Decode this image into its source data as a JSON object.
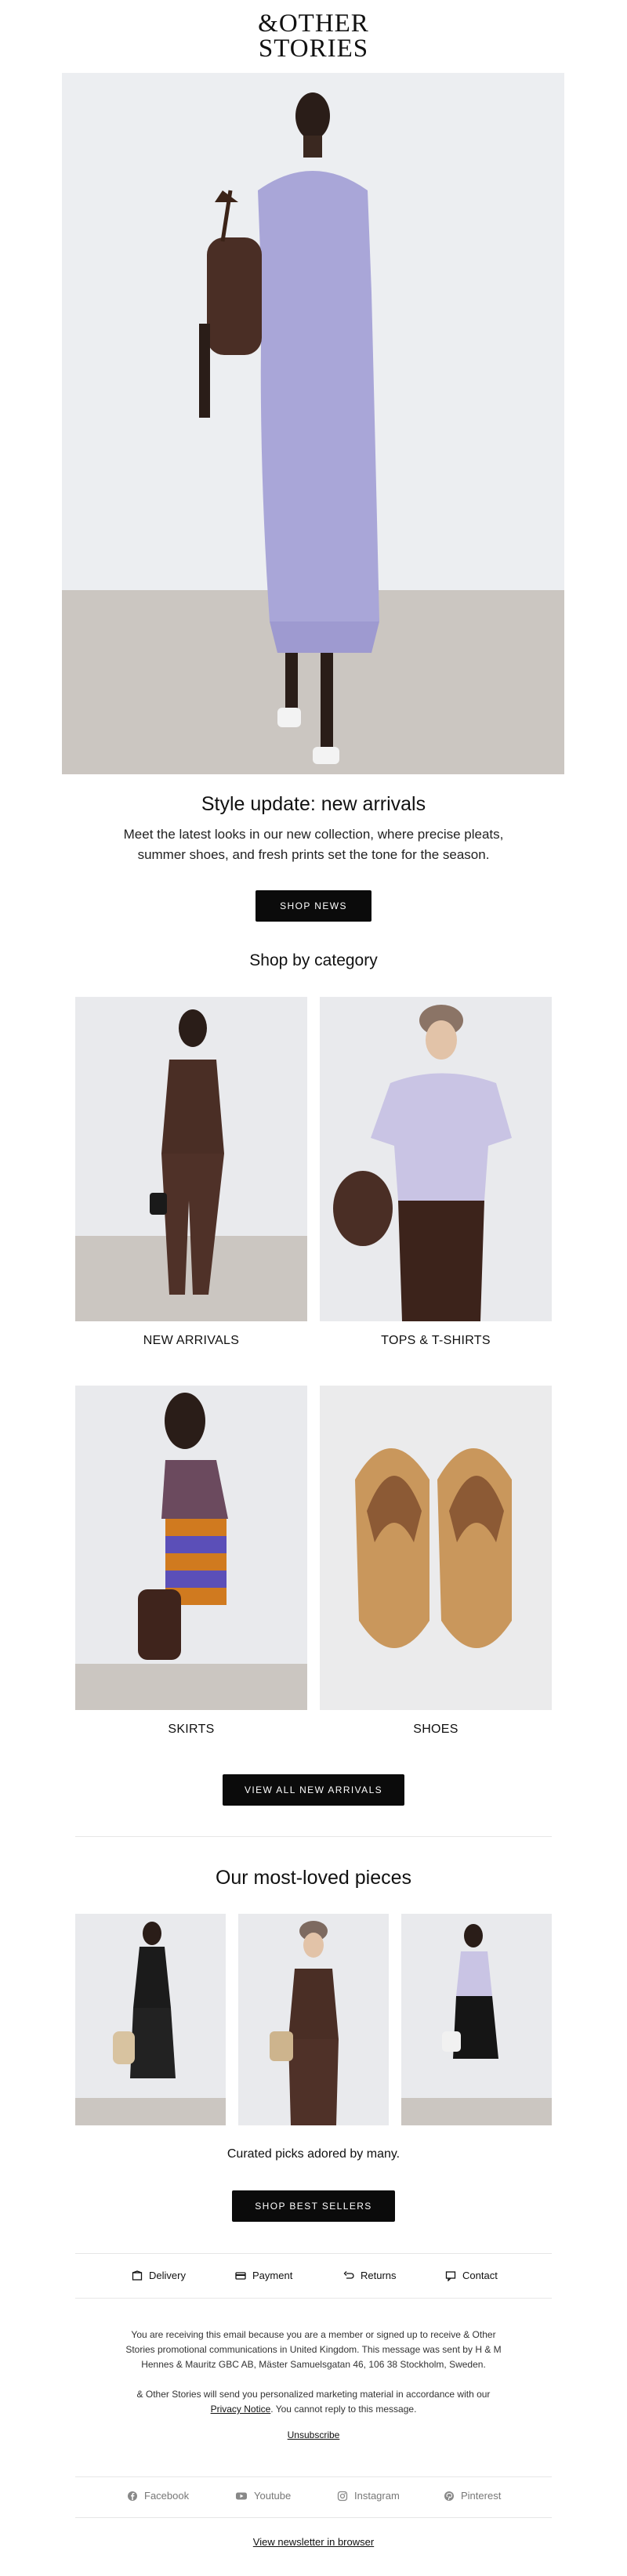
{
  "brand": {
    "logo_line1": "&OTHER",
    "logo_line2": "STORIES"
  },
  "hero": {
    "title": "Style update: new arrivals",
    "text_line1": "Meet the latest looks in our new collection, where precise pleats,",
    "text_line2": "summer shoes, and fresh prints set the tone for the season.",
    "button": "SHOP NEWS"
  },
  "categories": {
    "title": "Shop by category",
    "items": [
      {
        "label": "NEW ARRIVALS"
      },
      {
        "label": "TOPS & T-SHIRTS"
      },
      {
        "label": "SKIRTS"
      },
      {
        "label": "SHOES"
      }
    ],
    "button": "VIEW ALL NEW ARRIVALS"
  },
  "bestsellers": {
    "title": "Our most-loved pieces",
    "text": "Curated picks adored by many.",
    "button": "SHOP BEST SELLERS"
  },
  "utility": [
    {
      "label": "Delivery",
      "icon": "box-icon"
    },
    {
      "label": "Payment",
      "icon": "card-icon"
    },
    {
      "label": "Returns",
      "icon": "return-icon"
    },
    {
      "label": "Contact",
      "icon": "chat-icon"
    }
  ],
  "legal": {
    "p1_line1": "You are receiving this email because you are a member or signed up to receive & Other",
    "p1_line2": "Stories promotional communications in United Kingdom. This message was sent by H & M",
    "p1_line3": "Hennes & Mauritz GBC AB, Mäster Samuelsgatan 46, 106 38 Stockholm, Sweden.",
    "p2_line1": "& Other Stories will send you personalized marketing material in accordance with our",
    "p2_link": "Privacy Notice",
    "p2_after": ". You cannot reply to this message.",
    "unsubscribe": "Unsubscribe"
  },
  "social": [
    {
      "label": "Facebook",
      "icon": "facebook-icon"
    },
    {
      "label": "Youtube",
      "icon": "youtube-icon"
    },
    {
      "label": "Instagram",
      "icon": "instagram-icon"
    },
    {
      "label": "Pinterest",
      "icon": "pinterest-icon"
    }
  ],
  "footer": {
    "browser_link": "View newsletter in browser"
  },
  "colors": {
    "button_bg": "#0b0b0b",
    "dress": "#a9a6d8",
    "brown": "#4a2e25",
    "floor": "#cfcac6"
  }
}
